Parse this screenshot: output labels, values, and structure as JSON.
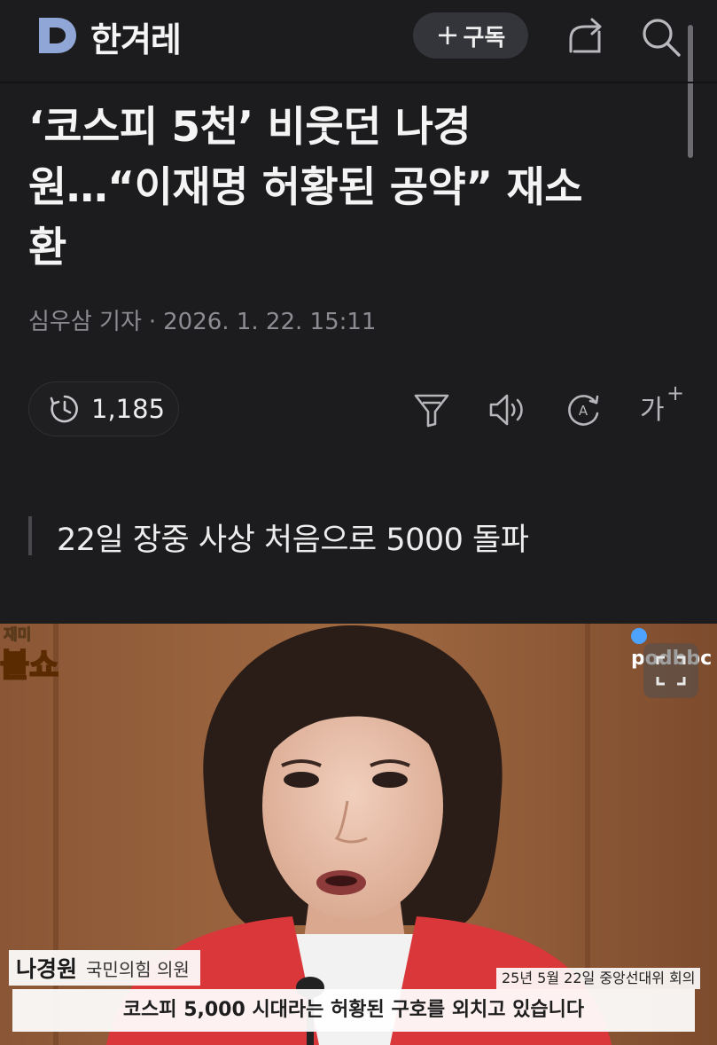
{
  "header": {
    "brand_name": "한겨레",
    "logo_letter": "D",
    "subscribe_label": "구독",
    "subscribe_plus": "+"
  },
  "article": {
    "headline_line1": "‘코스피 5천’ 비웃던 나경",
    "headline_line2": "원…“이재명 허황된 공약” 재소",
    "headline_line3": "환",
    "byline_author": "심우삼 기자",
    "byline_separator": "·",
    "byline_date": "2026. 1. 22. 15:11",
    "subheadline": "22일 장중 사상 처음으로 5000 돌파"
  },
  "toolbar": {
    "view_count": "1,185",
    "font_size_label": "가",
    "font_size_plus": "+"
  },
  "photo": {
    "watermark_top": "재미",
    "watermark_show": "불쇼",
    "brand_watermark": "podbbc",
    "name_plate_name": "나경원",
    "name_plate_role": "국민의힘 의원",
    "event_label": "25년 5월 22일 중앙선대위 회의",
    "caption": "코스피 5,000 시대라는 허황된 구호를 외치고 있습니다"
  },
  "colors": {
    "background": "#1c1c1e",
    "logo_blue": "#8fa6d6",
    "chip_bg": "#34353a",
    "jacket_red": "#d9373a"
  },
  "icons": [
    "logo-d-icon",
    "share-icon",
    "search-icon",
    "clock-icon",
    "filter-icon",
    "speaker-icon",
    "translate-icon",
    "font-size-icon",
    "expand-icon"
  ]
}
